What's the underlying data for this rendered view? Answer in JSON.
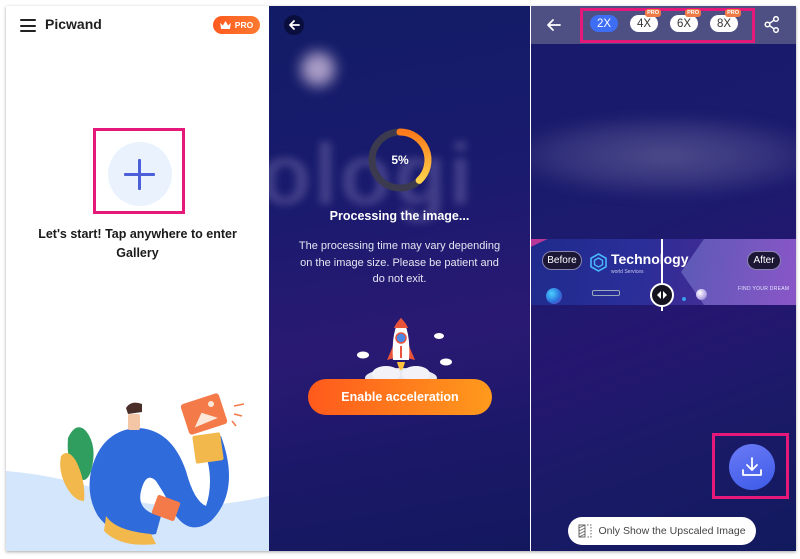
{
  "home_screen": {
    "app_title": "Picwand",
    "pro_badge": "PRO",
    "start_prompt": "Let's start! Tap anywhere to enter Gallery",
    "icons": {
      "menu": "hamburger-icon",
      "crown": "crown-icon",
      "add": "plus-icon"
    }
  },
  "processing_screen": {
    "progress_percent": 5,
    "progress_label": "5%",
    "title": "Processing the image...",
    "description": "The processing time may vary depending on the image size. Please be patient and do not exit.",
    "background_text": "ologi",
    "accelerate_button": "Enable acceleration",
    "icons": {
      "back": "back-arrow-icon",
      "rocket": "rocket-icon"
    }
  },
  "result_screen": {
    "scale_options": [
      {
        "label": "2X",
        "pro": false,
        "selected": true
      },
      {
        "label": "4X",
        "pro": true,
        "selected": false
      },
      {
        "label": "6X",
        "pro": true,
        "selected": false
      },
      {
        "label": "8X",
        "pro": true,
        "selected": false
      }
    ],
    "pro_tag": "PRO",
    "compare": {
      "before_label": "Before",
      "after_label": "After",
      "brand_name": "Technology",
      "brand_subtitle": "world Services",
      "tagline": "FIND YOUR DREAM"
    },
    "toggle_label": "Only Show the Upscaled Image",
    "icons": {
      "back": "back-arrow-icon",
      "share": "share-icon",
      "download": "download-icon",
      "compare_handle": "compare-handle-icon",
      "toggle": "split-view-icon"
    }
  },
  "colors": {
    "highlight_border": "#e5197a",
    "pro_orange": "#ff5a1f",
    "active_chip": "#3d6ef5",
    "accent_blue": "#4a5fd8",
    "dark_bg": "#1a1a6e"
  }
}
